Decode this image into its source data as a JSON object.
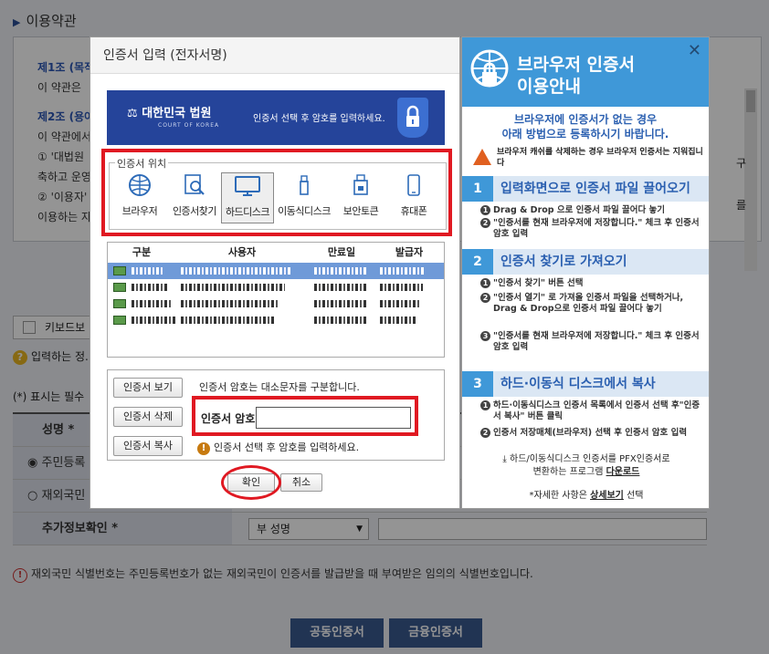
{
  "background": {
    "section_title": "이용약관",
    "terms": [
      {
        "text": "제1조 (목적",
        "heading": true
      },
      {
        "text": "이 약관은 ",
        "heading": false
      },
      {
        "text": "제2조 (용어",
        "heading": true
      },
      {
        "text": "이 약관에서",
        "heading": false
      },
      {
        "text": "① '대법원",
        "heading": false
      },
      {
        "text": "축하고 운영",
        "heading": false
      },
      {
        "text": "② '이용자'",
        "heading": false
      },
      {
        "text": "이용하는 자",
        "heading": false
      }
    ],
    "keyboard_label": "키보드보",
    "notice_input": "입력하는 정.",
    "required_note": "(*) 표시는 필수",
    "form": {
      "name_label": "성명 *",
      "resident_label": "주민등록",
      "foreigner_label": "재외국민",
      "extra_label": "추가정보확인 *",
      "extra_select": "부 성명",
      "extra_value": "",
      "char_fragment": "구",
      "char_fragment2": "를"
    },
    "foreigner_note": "재외국민 식별번호는 주민등록번호가 없는 재외국민이 인증서를 발급받을 때 부여받은 임의의 식별번호입니다.",
    "btn_joint": "공동인증서",
    "btn_finance": "금융인증서"
  },
  "dialog": {
    "title": "인증서 입력 (전자서명)",
    "banner_logo": "대한민국 법원",
    "banner_sub": "COURT OF KOREA",
    "banner_msg": "인증서 선택 후 암호를 입력하세요.",
    "location_legend": "인증서 위치",
    "locations": [
      {
        "label": "브라우저",
        "icon": "globe-icon"
      },
      {
        "label": "인증서찾기",
        "icon": "search-cert-icon"
      },
      {
        "label": "하드디스크",
        "icon": "monitor-icon"
      },
      {
        "label": "이동식디스크",
        "icon": "usb-icon"
      },
      {
        "label": "보안토큰",
        "icon": "token-icon"
      },
      {
        "label": "휴대폰",
        "icon": "phone-icon"
      }
    ],
    "selected_location": "하드디스크",
    "table_headers": [
      "구분",
      "사용자",
      "만료일",
      "발급자"
    ],
    "buttons": {
      "view": "인증서 보기",
      "delete": "인증서 삭제",
      "copy": "인증서 복사",
      "ok": "확인",
      "cancel": "취소"
    },
    "case_hint": "인증서 암호는 대소문자를 구분합니다.",
    "password_label": "인증서 암호",
    "password_value": "",
    "warning": "인증서 선택 후 암호를 입력하세요."
  },
  "guide": {
    "title_line1": "브라우저 인증서",
    "title_line2": "이용안내",
    "subtitle_line1": "브라우저에 인증서가 없는 경우",
    "subtitle_line2": "아래 방법으로 등록하시기 바랍니다.",
    "warning": "브라우저 캐쉬를 삭제하는 경우 브라우저 인증서는 지워집니다",
    "sections": [
      {
        "num": "1",
        "title": "입력화면으로 인증서 파일 끌어오기",
        "steps": [
          "Drag & Drop 으로 인증서 파일 끌어다 놓기",
          "\"인증서를 현재 브라우저에 저장합니다.\" 체크 후 인증서 암호 입력"
        ]
      },
      {
        "num": "2",
        "title": "인증서 찾기로 가져오기",
        "steps": [
          "\"인증서 찾기\" 버튼 선택",
          "\"인증서 열기\" 로 가져올 인증서 파일을 선택하거나, Drag & Drop으로 인증서 파일 끌어다 놓기",
          "\"인증서를 현재 브라우저에 저장합니다.\" 체크 후 인증서 암호 입력"
        ]
      },
      {
        "num": "3",
        "title": "하드·이동식 디스크에서 복사",
        "steps": [
          "하드·이동식디스크 인증서 목록에서 인증서 선택 후\"인증서 복사\" 버튼 클릭",
          "인증서 저장매체(브라우저) 선택 후 인증서 암호 입력"
        ]
      }
    ],
    "footer1": "하드/이동식디스크 인증서를 PFX인증서로",
    "footer2_prefix": "변환하는 프로그램 ",
    "footer2_link": "다운로드",
    "footer3_prefix": "*자세한 사항은 ",
    "footer3_link": "상세보기",
    "footer3_suffix": " 선택"
  }
}
